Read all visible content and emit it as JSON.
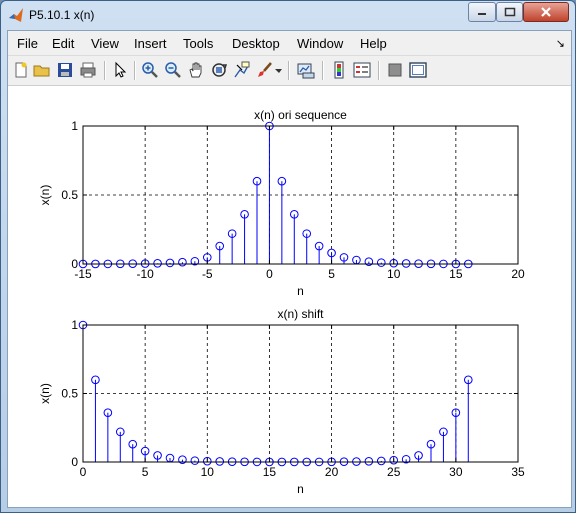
{
  "window": {
    "title": "P5.10.1 x(n)",
    "controls": {
      "minimize_icon": "minimize-icon",
      "maximize_icon": "maximize-icon",
      "close_icon": "close-icon"
    }
  },
  "menubar": {
    "items": [
      "File",
      "Edit",
      "View",
      "Insert",
      "Tools",
      "Desktop",
      "Window",
      "Help"
    ],
    "dock_glyph": "↘"
  },
  "toolbar": {
    "buttons": [
      "new-figure",
      "open-file",
      "save",
      "print",
      "edit-plot-arrow",
      "zoom-in",
      "zoom-out",
      "pan",
      "rotate-3d",
      "data-cursor",
      "brush",
      "brush-dropdown",
      "link-plot",
      "insert-colorbar",
      "insert-legend",
      "hide-plot-tools",
      "show-plot-tools"
    ]
  },
  "chart_data": [
    {
      "type": "stem",
      "title": "x(n) ori sequence",
      "xlabel": "n",
      "ylabel": "x(n)",
      "xlim": [
        -15,
        20
      ],
      "ylim": [
        0,
        1
      ],
      "xticks": [
        "-15",
        "-10",
        "-5",
        "0",
        "5",
        "10",
        "15",
        "20"
      ],
      "yticks": [
        "0",
        "0.5",
        "1"
      ],
      "grid": true,
      "color": "#0000ff",
      "x": [
        -15,
        -14,
        -13,
        -12,
        -11,
        -10,
        -9,
        -8,
        -7,
        -6,
        -5,
        -4,
        -3,
        -2,
        -1,
        0,
        1,
        2,
        3,
        4,
        5,
        6,
        7,
        8,
        9,
        10,
        11,
        12,
        13,
        14,
        15,
        16
      ],
      "y": [
        0.0003,
        0.0005,
        0.0008,
        0.0012,
        0.002,
        0.003,
        0.005,
        0.008,
        0.013,
        0.02,
        0.048,
        0.13,
        0.22,
        0.36,
        0.6,
        1.0,
        0.6,
        0.36,
        0.22,
        0.13,
        0.08,
        0.048,
        0.029,
        0.017,
        0.01,
        0.006,
        0.004,
        0.002,
        0.0013,
        0.0008,
        0.0005,
        0.0003
      ]
    },
    {
      "type": "stem",
      "title": "x(n) shift",
      "xlabel": "n",
      "ylabel": "x(n)",
      "xlim": [
        0,
        35
      ],
      "ylim": [
        0,
        1
      ],
      "xticks": [
        "0",
        "5",
        "10",
        "15",
        "20",
        "25",
        "30",
        "35"
      ],
      "yticks": [
        "0",
        "0.5",
        "1"
      ],
      "grid": true,
      "color": "#0000ff",
      "x": [
        0,
        1,
        2,
        3,
        4,
        5,
        6,
        7,
        8,
        9,
        10,
        11,
        12,
        13,
        14,
        15,
        16,
        17,
        18,
        19,
        20,
        21,
        22,
        23,
        24,
        25,
        26,
        27,
        28,
        29,
        30,
        31
      ],
      "y": [
        1.0,
        0.6,
        0.36,
        0.22,
        0.13,
        0.08,
        0.048,
        0.029,
        0.017,
        0.01,
        0.006,
        0.004,
        0.002,
        0.0013,
        0.0008,
        0.0005,
        0.0003,
        0.0003,
        0.0005,
        0.0008,
        0.0012,
        0.002,
        0.003,
        0.005,
        0.008,
        0.013,
        0.02,
        0.048,
        0.13,
        0.22,
        0.36,
        0.6
      ]
    }
  ]
}
